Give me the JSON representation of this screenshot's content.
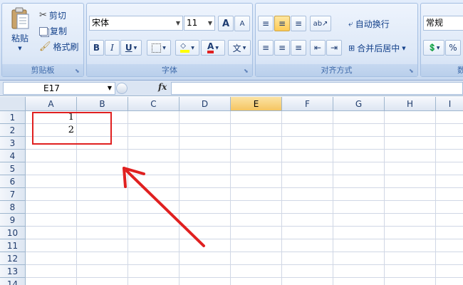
{
  "clipboard": {
    "paste_label": "粘贴",
    "cut_label": "剪切",
    "copy_label": "复制",
    "format_painter_label": "格式刷",
    "group_label": "剪贴板"
  },
  "font": {
    "font_name": "宋体",
    "font_size": "11",
    "bold": "B",
    "italic": "I",
    "underline": "U",
    "grow": "A",
    "shrink": "A",
    "phonetic": "文",
    "group_label": "字体"
  },
  "alignment": {
    "wrap_text_label": "自动换行",
    "merge_center_label": "合并后居中",
    "group_label": "对齐方式"
  },
  "number": {
    "format_value": "常规",
    "percent": "%",
    "group_label": "数"
  },
  "formula_bar": {
    "name_box": "E17",
    "fx": "fx"
  },
  "columns": [
    "A",
    "B",
    "C",
    "D",
    "E",
    "F",
    "G",
    "H",
    "I"
  ],
  "selected_column": "E",
  "rows": [
    "1",
    "2",
    "3",
    "4",
    "5",
    "6",
    "7",
    "8",
    "9",
    "10",
    "11",
    "12",
    "13",
    "14"
  ],
  "cells": {
    "A1": "1",
    "A2": "2"
  },
  "colors": {
    "annotation": "#e02020",
    "ribbon": "#dde8f7",
    "selected_header": "#f5c561"
  }
}
